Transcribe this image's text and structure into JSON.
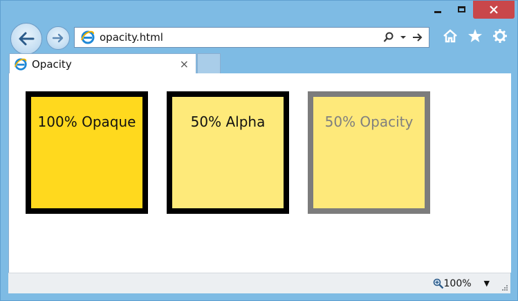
{
  "window": {
    "controls": {
      "minimize_icon": "minimize-icon",
      "maximize_icon": "maximize-icon",
      "close_icon": "close-icon",
      "close_color": "#c9474a"
    }
  },
  "toolbar": {
    "back_icon": "back-arrow-icon",
    "forward_icon": "forward-arrow-icon",
    "address": {
      "url": "opacity.html",
      "search_icon": "search-icon",
      "dropdown_icon": "chevron-down-icon",
      "go_icon": "go-arrow-icon"
    },
    "right_icons": [
      "home-icon",
      "favorites-star-icon",
      "settings-gear-icon"
    ]
  },
  "tabs": [
    {
      "title": "Opacity",
      "close_glyph": "×"
    }
  ],
  "content": {
    "boxes": [
      {
        "label": "100% Opaque",
        "background": "#ffd91e",
        "border": "#000000",
        "text_color": "#111111"
      },
      {
        "label": "50% Alpha",
        "background": "#feea7a",
        "border": "#000000",
        "text_color": "#111111"
      },
      {
        "label": "50% Opacity",
        "background": "#fee97a",
        "border": "#7c7c7c",
        "text_color": "#7f7f7f"
      }
    ]
  },
  "statusbar": {
    "zoom_label": "100%",
    "zoom_icon": "zoom-magnifier-icon",
    "zoom_caret": "▼"
  },
  "colors": {
    "chrome": "#7ebbe4",
    "accent": "#1e88d6"
  }
}
